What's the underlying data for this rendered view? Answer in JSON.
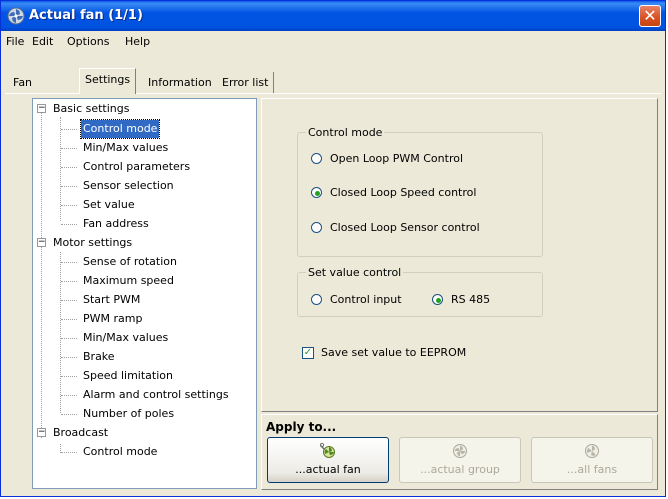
{
  "window": {
    "title": "Actual fan (1/1)",
    "close_label": "✕"
  },
  "menu": [
    "File",
    "Edit",
    "Options",
    "Help"
  ],
  "tabs": [
    "Fan",
    "Settings",
    "Information",
    "Error list"
  ],
  "active_tab": "Settings",
  "tree": {
    "groups": [
      {
        "label": "Basic settings",
        "expander": "−",
        "items": [
          "Control mode",
          "Min/Max values",
          "Control parameters",
          "Sensor selection",
          "Set value",
          "Fan address"
        ]
      },
      {
        "label": "Motor settings",
        "expander": "−",
        "items": [
          "Sense of rotation",
          "Maximum speed",
          "Start PWM",
          "PWM ramp",
          "Min/Max values",
          "Brake",
          "Speed limitation",
          "Alarm and control settings",
          "Number of poles"
        ]
      },
      {
        "label": "Broadcast",
        "expander": "−",
        "items": [
          "Control mode"
        ]
      }
    ],
    "selected": "Control mode"
  },
  "control_mode": {
    "title": "Control mode",
    "options": [
      {
        "label": "Open Loop PWM Control",
        "checked": false
      },
      {
        "label": "Closed Loop Speed control",
        "checked": true
      },
      {
        "label": "Closed Loop Sensor control",
        "checked": false
      }
    ]
  },
  "set_value_control": {
    "title": "Set value control",
    "options": [
      {
        "label": "Control input",
        "checked": false
      },
      {
        "label": "RS 485",
        "checked": true
      }
    ]
  },
  "save_eeprom": {
    "label": "Save set value to EEPROM",
    "checked": true,
    "mark": "✓"
  },
  "apply": {
    "title": "Apply to...",
    "buttons": [
      {
        "label": "...actual fan",
        "enabled": true,
        "icon": "fan-wrench-icon"
      },
      {
        "label": "...actual group",
        "enabled": false,
        "icon": "fan-group-icon"
      },
      {
        "label": "...all fans",
        "enabled": false,
        "icon": "all-fans-icon"
      }
    ]
  },
  "colors": {
    "titlebar": "#0054e3",
    "selection": "#316ac5",
    "radio_dot": "#21a121"
  }
}
